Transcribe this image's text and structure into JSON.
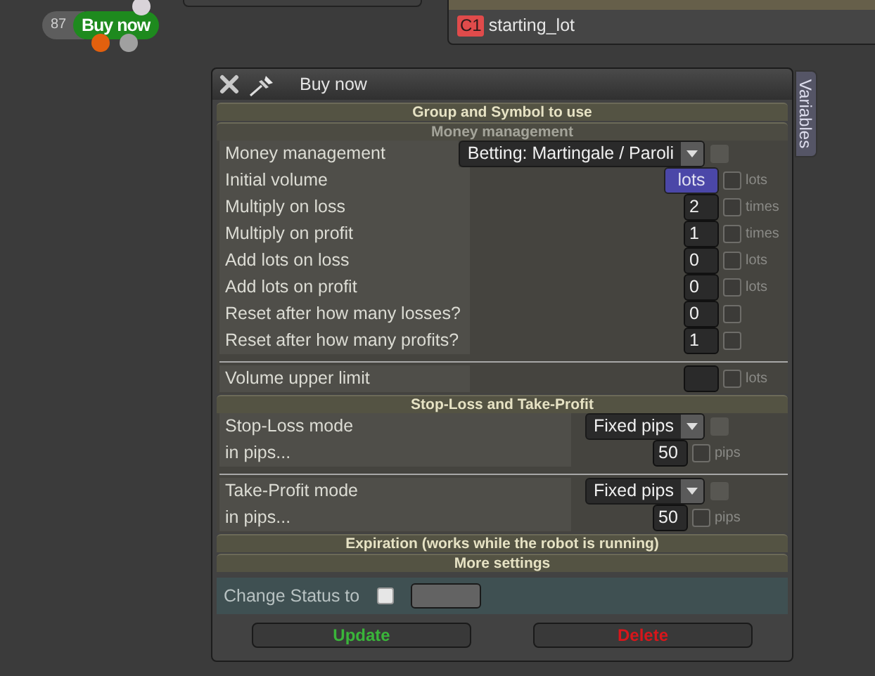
{
  "node": {
    "count": "87",
    "label": "Buy now"
  },
  "constants": {
    "items": [
      {
        "badge": "C1",
        "name": "starting_lot"
      }
    ]
  },
  "window": {
    "title": "Buy now",
    "side_tab": "Variables"
  },
  "sections": [
    {
      "title": "Group and Symbol to use",
      "kind": "main"
    },
    {
      "title": "Money management",
      "kind": "sub",
      "groups": [
        [
          {
            "label": "Money management",
            "kind": "select",
            "value": "Betting: Martingale / Paroli",
            "checkbox": {
              "checked": false,
              "disabled": true
            }
          },
          {
            "label": "Initial volume",
            "kind": "button",
            "value": "lots",
            "checkbox": {
              "checked": false,
              "disabled": false
            },
            "unit": "lots"
          },
          {
            "label": "Multiply on loss",
            "kind": "number",
            "value": "2",
            "checkbox": {
              "checked": false,
              "disabled": false
            },
            "unit": "times"
          },
          {
            "label": "Multiply on profit",
            "kind": "number",
            "value": "1",
            "checkbox": {
              "checked": false,
              "disabled": false
            },
            "unit": "times"
          },
          {
            "label": "Add lots on loss",
            "kind": "number",
            "value": "0",
            "checkbox": {
              "checked": false,
              "disabled": false
            },
            "unit": "lots"
          },
          {
            "label": "Add lots on profit",
            "kind": "number",
            "value": "0",
            "checkbox": {
              "checked": false,
              "disabled": false
            },
            "unit": "lots"
          },
          {
            "label": "Reset after how many losses?",
            "kind": "number",
            "value": "0",
            "checkbox": {
              "checked": false,
              "disabled": false
            }
          },
          {
            "label": "Reset after how many profits?",
            "kind": "number",
            "value": "1",
            "checkbox": {
              "checked": false,
              "disabled": false
            }
          }
        ],
        [
          {
            "label": "Volume upper limit",
            "kind": "number",
            "checkbox": {
              "checked": false,
              "disabled": false
            },
            "unit": "lots"
          }
        ]
      ]
    },
    {
      "title": "Stop-Loss and Take-Profit",
      "kind": "main",
      "groups": [
        [
          {
            "label": "Stop-Loss mode",
            "kind": "select",
            "value": "Fixed pips",
            "checkbox": {
              "checked": false,
              "disabled": true
            }
          },
          {
            "label": "in pips...",
            "kind": "number",
            "value": "50",
            "checkbox": {
              "checked": false,
              "disabled": false
            },
            "unit": "pips"
          }
        ],
        [
          {
            "label": "Take-Profit mode",
            "kind": "select",
            "value": "Fixed pips",
            "checkbox": {
              "checked": false,
              "disabled": true
            }
          },
          {
            "label": "in pips...",
            "kind": "number",
            "value": "50",
            "checkbox": {
              "checked": false,
              "disabled": false
            },
            "unit": "pips"
          }
        ]
      ]
    },
    {
      "title": "Expiration (works while the robot is running)",
      "kind": "main"
    },
    {
      "title": "More settings",
      "kind": "main"
    }
  ],
  "status": {
    "label": "Change Status to",
    "checked": false
  },
  "buttons": [
    {
      "label": "Update",
      "kind": "confirm"
    },
    {
      "label": "Delete",
      "kind": "danger"
    }
  ]
}
